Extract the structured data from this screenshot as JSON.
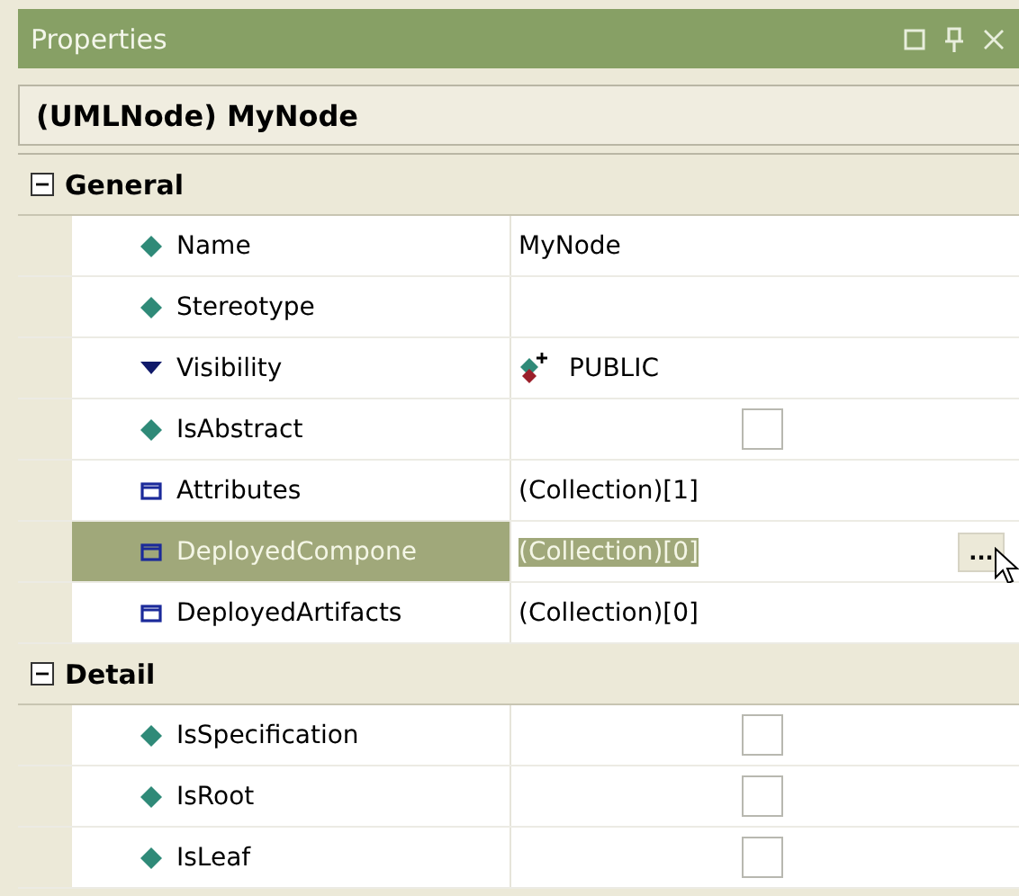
{
  "panel": {
    "title": "Properties"
  },
  "object_header": "(UMLNode) MyNode",
  "sections": [
    {
      "title": "General",
      "expanded": true,
      "rows": [
        {
          "name": "Name",
          "kind": "attribute",
          "selected": false,
          "value": {
            "kind": "text",
            "text": "MyNode"
          }
        },
        {
          "name": "Stereotype",
          "kind": "attribute",
          "selected": false
        },
        {
          "name": "Visibility",
          "kind": "enumeration",
          "selected": false,
          "value": {
            "kind": "visibility",
            "text": "PUBLIC"
          }
        },
        {
          "name": "IsAbstract",
          "kind": "attribute",
          "selected": false,
          "value": {
            "kind": "checkbox",
            "checked": false
          }
        },
        {
          "name": "Attributes",
          "kind": "collection",
          "selected": false,
          "value": {
            "kind": "text",
            "text": "(Collection)[1]"
          }
        },
        {
          "name": "DeployedCompone",
          "kind": "collection",
          "selected": true,
          "value": {
            "kind": "editor",
            "text": "(Collection)[0]",
            "button": "..."
          }
        },
        {
          "name": "DeployedArtifacts",
          "kind": "collection",
          "selected": false,
          "value": {
            "kind": "text",
            "text": "(Collection)[0]"
          }
        }
      ]
    },
    {
      "title": "Detail",
      "expanded": true,
      "rows": [
        {
          "name": "IsSpecification",
          "kind": "attribute",
          "selected": false,
          "value": {
            "kind": "checkbox",
            "checked": false
          }
        },
        {
          "name": "IsRoot",
          "kind": "attribute",
          "selected": false,
          "value": {
            "kind": "checkbox",
            "checked": false
          }
        },
        {
          "name": "IsLeaf",
          "kind": "attribute",
          "selected": false,
          "value": {
            "kind": "checkbox",
            "checked": false
          }
        }
      ]
    }
  ]
}
